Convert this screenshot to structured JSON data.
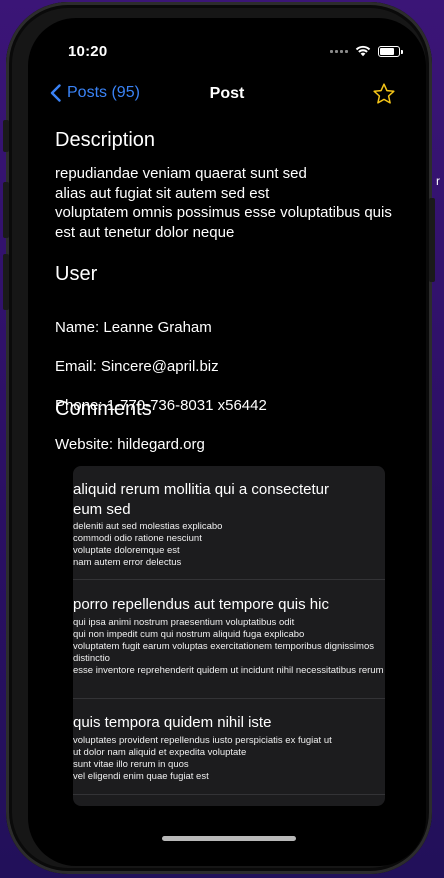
{
  "status_bar": {
    "time": "10:20",
    "battery_level": 0.9
  },
  "nav": {
    "back_label": "Posts (95)",
    "title": "Post",
    "accent": "#3a83f6",
    "star_color": "#f5c518"
  },
  "description": {
    "heading": "Description",
    "body": "repudiandae veniam quaerat sunt sed\nalias aut fugiat sit autem sed est\nvoluptatem omnis possimus esse voluptatibus quis\nest aut tenetur dolor neque"
  },
  "user": {
    "heading": "User",
    "name": "Name: Leanne Graham",
    "email": "Email: Sincere@april.biz",
    "phone": "Phone: 1-770-736-8031 x56442",
    "website": "Website: hildegard.org"
  },
  "comments": {
    "heading": "Comments",
    "items": [
      {
        "title": "aliquid rerum mollitia qui a consectetur eum sed",
        "body": "deleniti aut sed molestias explicabo\ncommodi odio ratione nesciunt\nvoluptate doloremque est\nnam autem error delectus"
      },
      {
        "title": "porro repellendus aut tempore quis hic",
        "body": "qui ipsa animi nostrum praesentium voluptatibus odit\nqui non impedit cum qui nostrum aliquid fuga explicabo\nvoluptatem fugit earum voluptas exercitationem temporibus dignissimos distinctio\nesse inventore reprehenderit quidem ut incidunt nihil necessitatibus rerum"
      },
      {
        "title": "quis tempora quidem nihil iste",
        "body": "voluptates provident repellendus iusto perspiciatis ex fugiat ut\nut dolor nam aliquid et expedita voluptate\nsunt vitae illo rerum in quos\nvel eligendi enim quae fugiat est"
      }
    ]
  },
  "desktop": {
    "edge_glyph": "r"
  }
}
